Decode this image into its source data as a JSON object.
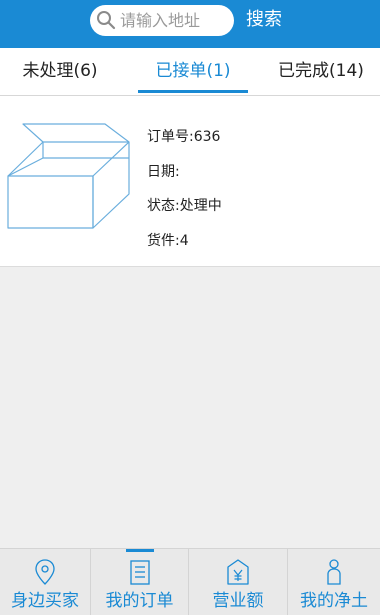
{
  "header": {
    "search_placeholder": "请输入地址",
    "search_button": "搜索"
  },
  "tabs": [
    {
      "label": "未处理(6)",
      "active": false
    },
    {
      "label": "已接单(1)",
      "active": true
    },
    {
      "label": "已完成(14)",
      "active": false
    }
  ],
  "order": {
    "number": "订单号:636",
    "date": "日期:",
    "status": "状态:处理中",
    "items": "货件:4"
  },
  "bottom_nav": [
    {
      "label": "身边买家",
      "icon": "location-pin-icon"
    },
    {
      "label": "我的订单",
      "icon": "order-list-icon",
      "active": true
    },
    {
      "label": "营业额",
      "icon": "revenue-icon"
    },
    {
      "label": "我的净土",
      "icon": "person-icon"
    }
  ],
  "colors": {
    "accent": "#1a8ad4",
    "background": "#efefef"
  }
}
